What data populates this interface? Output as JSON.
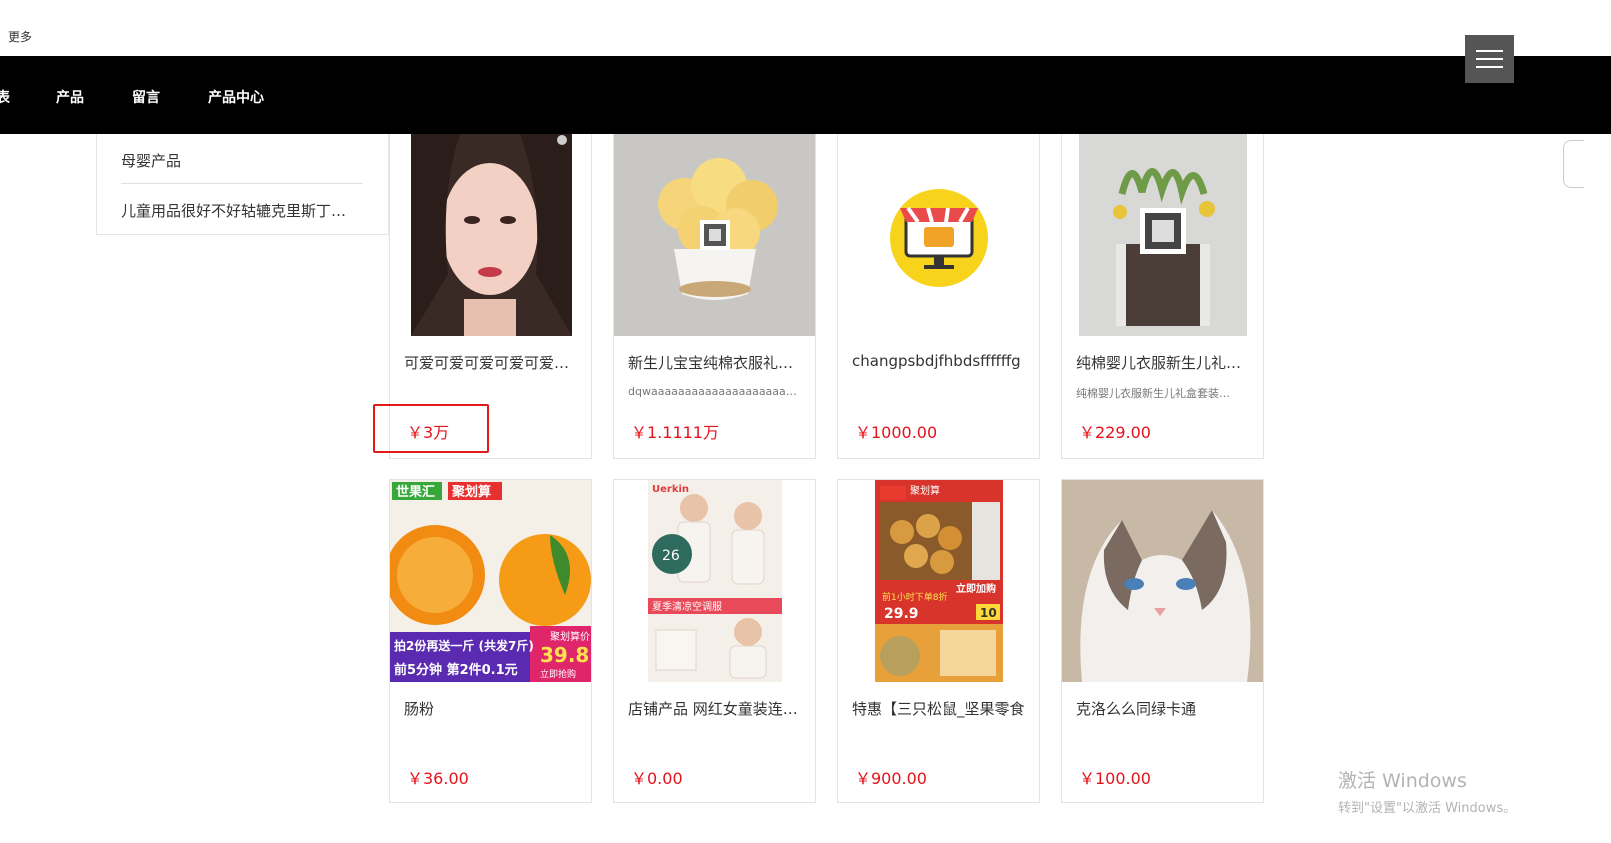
{
  "top": {
    "more_label": "更多"
  },
  "nav": {
    "items": [
      "表",
      "产品",
      "留言",
      "产品中心"
    ]
  },
  "sidebar": {
    "items": [
      "母婴产品",
      "儿童用品很好不好轱辘克里斯丁…"
    ]
  },
  "products": [
    {
      "title": "可爱可爱可爱可爱可爱可爱",
      "subtitle": "",
      "price": "￥3万",
      "image": "portrait-photo"
    },
    {
      "title": "新生儿宝宝纯棉衣服礼盒套装",
      "subtitle": "dqwaaaaaaaaaaaaaaaaaaaaaf…",
      "price": "￥1.1111万",
      "image": "flower-pot-with-qr"
    },
    {
      "title": "changpsbdjfhbdsffffffg",
      "subtitle": "",
      "price": "￥1000.00",
      "image": "shop-icon"
    },
    {
      "title": "纯棉婴儿衣服新生儿礼盒套装",
      "subtitle": "纯棉婴儿衣服新生儿礼盒套装…",
      "price": "￥229.00",
      "image": "succulent-with-qr"
    },
    {
      "title": "肠粉",
      "subtitle": "",
      "price": "￥36.00",
      "image": "oranges-ad",
      "image_text": [
        "世果汇",
        "聚划算",
        "拍2份再送一斤 (共发7斤)",
        "前5分钟 第2件0.1元",
        "聚划算价",
        "39.8",
        "立即抢购"
      ]
    },
    {
      "title": "店铺产品 网红女童装连衣裙",
      "subtitle": "",
      "price": "￥0.00",
      "image": "baby-clothes-ad",
      "image_text": [
        "Uerkin",
        "26",
        "夏季清凉空调服"
      ]
    },
    {
      "title": "特惠【三只松鼠_坚果零食",
      "subtitle": "",
      "price": "￥900.00",
      "image": "snack-ad",
      "image_text": [
        "聚划算",
        "立即加购",
        "前1小时下单8折",
        "29.9",
        "10"
      ]
    },
    {
      "title": "克洛么么同绿卡通",
      "subtitle": "",
      "price": "￥100.00",
      "image": "cat-photo"
    }
  ],
  "watermark": {
    "title": "激活 Windows",
    "subtitle": "转到\"设置\"以激活 Windows。"
  },
  "colors": {
    "nav_bg": "#000000",
    "price": "#e4121b",
    "highlight": "#e21a1a",
    "menu_btn": "#555555"
  }
}
